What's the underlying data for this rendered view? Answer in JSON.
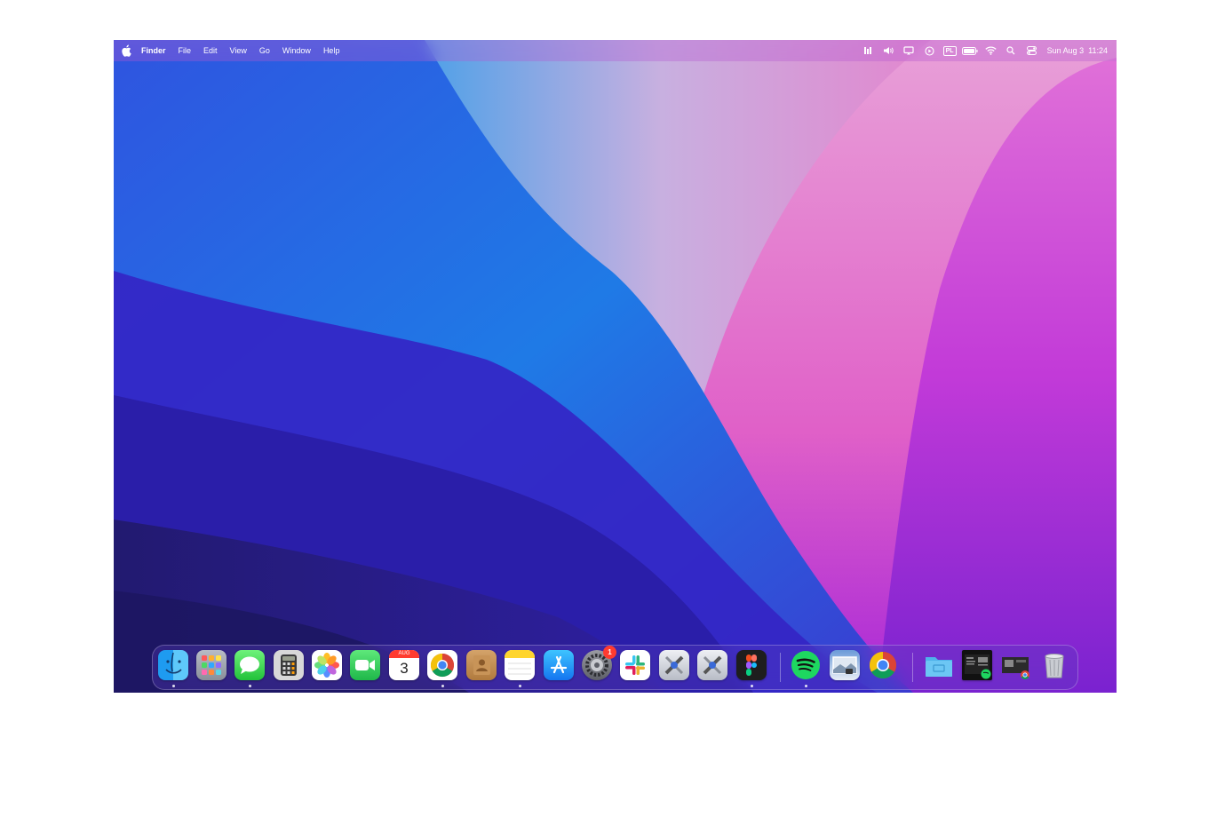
{
  "menubar": {
    "apple": "apple-logo",
    "app_name": "Finder",
    "menus": [
      "File",
      "Edit",
      "View",
      "Go",
      "Window",
      "Help"
    ],
    "keyboard_layout": "PL",
    "date": "Sun Aug 3",
    "time": "11:24"
  },
  "dock": {
    "calendar": {
      "month": "AUG",
      "day": "3"
    },
    "settings_badge": "1"
  },
  "colors": {
    "badge": "#ff3b30",
    "menubar_text": "#ffffff"
  }
}
